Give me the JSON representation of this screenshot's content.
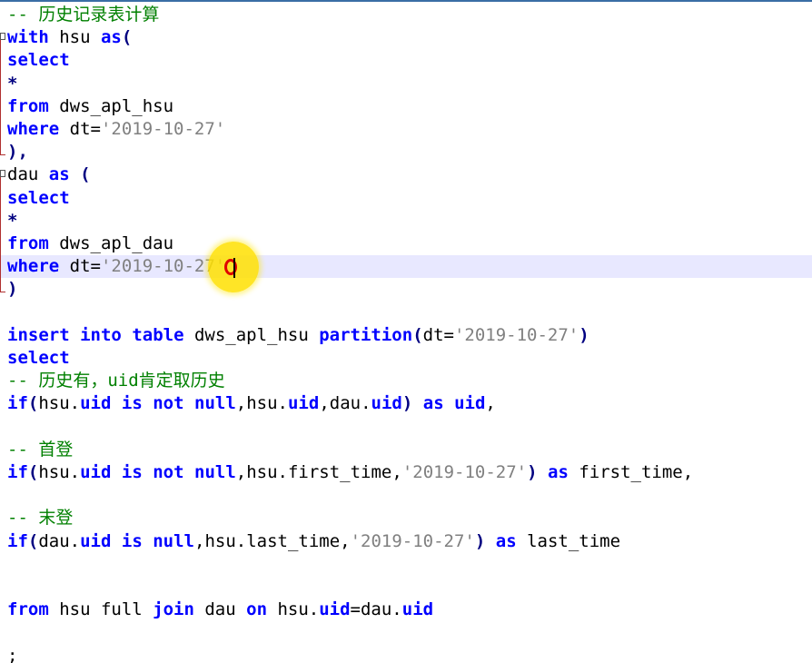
{
  "editor": {
    "language": "SQL",
    "current_line": 12,
    "lines": [
      [
        {
          "t": "cm",
          "v": "-- 历史记录表计算"
        }
      ],
      [
        {
          "t": "kw",
          "v": "with"
        },
        {
          "t": "p",
          "v": " hsu "
        },
        {
          "t": "kw",
          "v": "as"
        },
        {
          "t": "op",
          "v": "("
        }
      ],
      [
        {
          "t": "kw",
          "v": "select"
        }
      ],
      [
        {
          "t": "op",
          "v": "*"
        }
      ],
      [
        {
          "t": "kw",
          "v": "from"
        },
        {
          "t": "p",
          "v": " dws_apl_hsu"
        }
      ],
      [
        {
          "t": "kw",
          "v": "where"
        },
        {
          "t": "p",
          "v": " dt="
        },
        {
          "t": "str",
          "v": "'2019-10-27'"
        }
      ],
      [
        {
          "t": "op",
          "v": "),"
        }
      ],
      [
        {
          "t": "p",
          "v": "dau "
        },
        {
          "t": "kw",
          "v": "as"
        },
        {
          "t": "p",
          "v": " "
        },
        {
          "t": "op",
          "v": "("
        }
      ],
      [
        {
          "t": "kw",
          "v": "select"
        }
      ],
      [
        {
          "t": "op",
          "v": "*"
        }
      ],
      [
        {
          "t": "kw",
          "v": "from"
        },
        {
          "t": "p",
          "v": " dws_apl_dau"
        }
      ],
      [
        {
          "t": "kw",
          "v": "where"
        },
        {
          "t": "p",
          "v": " dt="
        },
        {
          "t": "str",
          "v": "'2019-10-27'"
        }
      ],
      [
        {
          "t": "op",
          "v": ")"
        }
      ],
      [],
      [
        {
          "t": "kw",
          "v": "insert"
        },
        {
          "t": "p",
          "v": " "
        },
        {
          "t": "kw",
          "v": "into"
        },
        {
          "t": "p",
          "v": " "
        },
        {
          "t": "kw",
          "v": "table"
        },
        {
          "t": "p",
          "v": " dws_apl_hsu "
        },
        {
          "t": "kw",
          "v": "partition"
        },
        {
          "t": "op",
          "v": "("
        },
        {
          "t": "p",
          "v": "dt="
        },
        {
          "t": "str",
          "v": "'2019-10-27'"
        },
        {
          "t": "op",
          "v": ")"
        }
      ],
      [
        {
          "t": "kw",
          "v": "select"
        }
      ],
      [
        {
          "t": "cm",
          "v": "-- 历史有，uid肯定取历史"
        }
      ],
      [
        {
          "t": "kw",
          "v": "if"
        },
        {
          "t": "op",
          "v": "("
        },
        {
          "t": "p",
          "v": "hsu."
        },
        {
          "t": "kw",
          "v": "uid"
        },
        {
          "t": "p",
          "v": " "
        },
        {
          "t": "kw",
          "v": "is"
        },
        {
          "t": "p",
          "v": " "
        },
        {
          "t": "kw",
          "v": "not"
        },
        {
          "t": "p",
          "v": " "
        },
        {
          "t": "kw",
          "v": "null"
        },
        {
          "t": "p",
          "v": ",hsu."
        },
        {
          "t": "kw",
          "v": "uid"
        },
        {
          "t": "p",
          "v": ",dau."
        },
        {
          "t": "kw",
          "v": "uid"
        },
        {
          "t": "op",
          "v": ")"
        },
        {
          "t": "p",
          "v": " "
        },
        {
          "t": "kw",
          "v": "as"
        },
        {
          "t": "p",
          "v": " "
        },
        {
          "t": "kw",
          "v": "uid"
        },
        {
          "t": "p",
          "v": ","
        }
      ],
      [],
      [
        {
          "t": "cm",
          "v": "-- 首登"
        }
      ],
      [
        {
          "t": "kw",
          "v": "if"
        },
        {
          "t": "op",
          "v": "("
        },
        {
          "t": "p",
          "v": "hsu."
        },
        {
          "t": "kw",
          "v": "uid"
        },
        {
          "t": "p",
          "v": " "
        },
        {
          "t": "kw",
          "v": "is"
        },
        {
          "t": "p",
          "v": " "
        },
        {
          "t": "kw",
          "v": "not"
        },
        {
          "t": "p",
          "v": " "
        },
        {
          "t": "kw",
          "v": "null"
        },
        {
          "t": "p",
          "v": ",hsu.first_time,"
        },
        {
          "t": "str",
          "v": "'2019-10-27'"
        },
        {
          "t": "op",
          "v": ")"
        },
        {
          "t": "p",
          "v": " "
        },
        {
          "t": "kw",
          "v": "as"
        },
        {
          "t": "p",
          "v": " first_time,"
        }
      ],
      [],
      [
        {
          "t": "cm",
          "v": "-- 末登"
        }
      ],
      [
        {
          "t": "kw",
          "v": "if"
        },
        {
          "t": "op",
          "v": "("
        },
        {
          "t": "p",
          "v": "dau."
        },
        {
          "t": "kw",
          "v": "uid"
        },
        {
          "t": "p",
          "v": " "
        },
        {
          "t": "kw",
          "v": "is"
        },
        {
          "t": "p",
          "v": " "
        },
        {
          "t": "kw",
          "v": "null"
        },
        {
          "t": "p",
          "v": ",hsu.last_time,"
        },
        {
          "t": "str",
          "v": "'2019-10-27'"
        },
        {
          "t": "op",
          "v": ")"
        },
        {
          "t": "p",
          "v": " "
        },
        {
          "t": "kw",
          "v": "as"
        },
        {
          "t": "p",
          "v": " last_time"
        }
      ],
      [],
      [],
      [
        {
          "t": "kw",
          "v": "from"
        },
        {
          "t": "p",
          "v": " hsu full "
        },
        {
          "t": "kw",
          "v": "join"
        },
        {
          "t": "p",
          "v": " dau "
        },
        {
          "t": "kw",
          "v": "on"
        },
        {
          "t": "p",
          "v": " hsu."
        },
        {
          "t": "kw",
          "v": "uid"
        },
        {
          "t": "p",
          "v": "=dau."
        },
        {
          "t": "kw",
          "v": "uid"
        }
      ],
      [],
      [
        {
          "t": "p",
          "v": ";"
        }
      ]
    ]
  },
  "colors": {
    "keyword": "#0000ff",
    "string": "#808080",
    "comment": "#008000",
    "operator": "#000080",
    "current_line": "#e8e8ff",
    "fold_marker": "#b03030",
    "click_highlight": "#ffe100"
  }
}
